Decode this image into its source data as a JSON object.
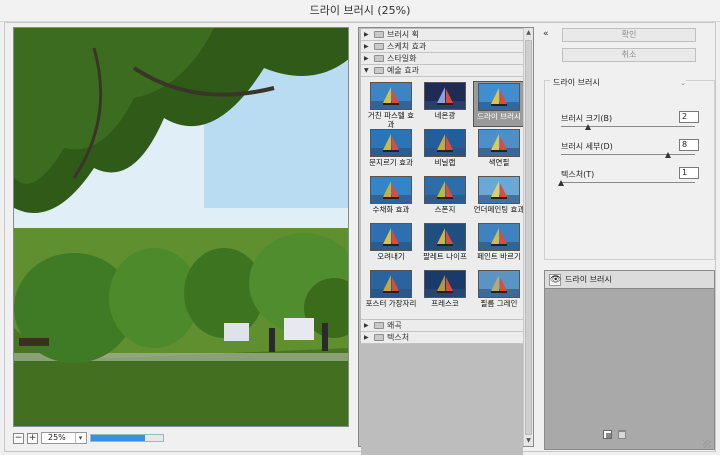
{
  "window": {
    "title": "드라이 브러시 (25%)"
  },
  "preview": {
    "zoom_value": "25%",
    "zoom_out_glyph": "−",
    "zoom_in_glyph": "+",
    "dropdown_glyph": "▾",
    "progress_fraction": 0.75
  },
  "gallery": {
    "categories_before": [
      {
        "label": "브러시 획",
        "expanded": false
      },
      {
        "label": "스케치 효과",
        "expanded": false
      },
      {
        "label": "스타일화",
        "expanded": false
      }
    ],
    "open_category": {
      "label": "예술 효과",
      "expanded": true
    },
    "thumbnails": [
      {
        "label": "거친 파스텔 효과"
      },
      {
        "label": "네온광"
      },
      {
        "label": "드라이 브러시",
        "selected": true
      },
      {
        "label": "문지르기 효과"
      },
      {
        "label": "비닐랩"
      },
      {
        "label": "색연필"
      },
      {
        "label": "수채화 효과"
      },
      {
        "label": "스폰지"
      },
      {
        "label": "언더페인팅 효과"
      },
      {
        "label": "오려내기"
      },
      {
        "label": "팔레트 나이프"
      },
      {
        "label": "페인트 바르기"
      },
      {
        "label": "포스터 가장자리"
      },
      {
        "label": "프레스코"
      },
      {
        "label": "필름 그레인"
      }
    ],
    "categories_after": [
      {
        "label": "왜곡",
        "expanded": false
      },
      {
        "label": "텍스처",
        "expanded": false
      }
    ],
    "collapsed_glyph": "▶",
    "expanded_glyph": "▼",
    "scroll_up_glyph": "▲",
    "scroll_down_glyph": "▼"
  },
  "panel": {
    "expand_glyph": "«",
    "ok_label": "확인",
    "cancel_label": "취소",
    "filter_select": "드라이 브러시",
    "filter_select_glyph": "⌄",
    "params": [
      {
        "label": "브러시 크기(B)",
        "value": "2",
        "min": 0,
        "max": 10
      },
      {
        "label": "브러시 세부(D)",
        "value": "8",
        "min": 0,
        "max": 10
      },
      {
        "label": "텍스처(T)",
        "value": "1",
        "min": 1,
        "max": 3
      }
    ]
  },
  "layers": {
    "items": [
      {
        "label": "드라이 브러시",
        "visible": true
      }
    ],
    "eye_glyph": "👁"
  }
}
